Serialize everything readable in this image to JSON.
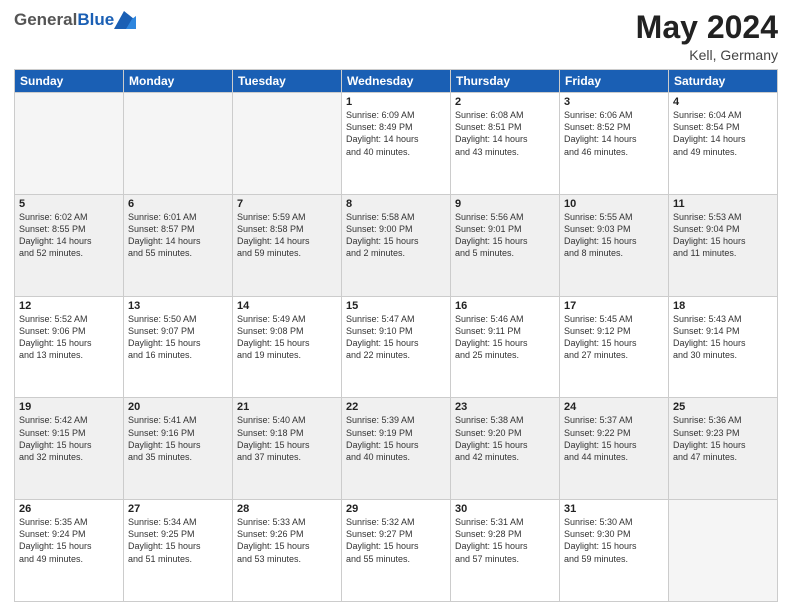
{
  "header": {
    "logo_general": "General",
    "logo_blue": "Blue",
    "month_year": "May 2024",
    "location": "Kell, Germany"
  },
  "days_header": [
    "Sunday",
    "Monday",
    "Tuesday",
    "Wednesday",
    "Thursday",
    "Friday",
    "Saturday"
  ],
  "weeks": [
    {
      "shaded": false,
      "days": [
        {
          "num": "",
          "info": ""
        },
        {
          "num": "",
          "info": ""
        },
        {
          "num": "",
          "info": ""
        },
        {
          "num": "1",
          "info": "Sunrise: 6:09 AM\nSunset: 8:49 PM\nDaylight: 14 hours\nand 40 minutes."
        },
        {
          "num": "2",
          "info": "Sunrise: 6:08 AM\nSunset: 8:51 PM\nDaylight: 14 hours\nand 43 minutes."
        },
        {
          "num": "3",
          "info": "Sunrise: 6:06 AM\nSunset: 8:52 PM\nDaylight: 14 hours\nand 46 minutes."
        },
        {
          "num": "4",
          "info": "Sunrise: 6:04 AM\nSunset: 8:54 PM\nDaylight: 14 hours\nand 49 minutes."
        }
      ]
    },
    {
      "shaded": true,
      "days": [
        {
          "num": "5",
          "info": "Sunrise: 6:02 AM\nSunset: 8:55 PM\nDaylight: 14 hours\nand 52 minutes."
        },
        {
          "num": "6",
          "info": "Sunrise: 6:01 AM\nSunset: 8:57 PM\nDaylight: 14 hours\nand 55 minutes."
        },
        {
          "num": "7",
          "info": "Sunrise: 5:59 AM\nSunset: 8:58 PM\nDaylight: 14 hours\nand 59 minutes."
        },
        {
          "num": "8",
          "info": "Sunrise: 5:58 AM\nSunset: 9:00 PM\nDaylight: 15 hours\nand 2 minutes."
        },
        {
          "num": "9",
          "info": "Sunrise: 5:56 AM\nSunset: 9:01 PM\nDaylight: 15 hours\nand 5 minutes."
        },
        {
          "num": "10",
          "info": "Sunrise: 5:55 AM\nSunset: 9:03 PM\nDaylight: 15 hours\nand 8 minutes."
        },
        {
          "num": "11",
          "info": "Sunrise: 5:53 AM\nSunset: 9:04 PM\nDaylight: 15 hours\nand 11 minutes."
        }
      ]
    },
    {
      "shaded": false,
      "days": [
        {
          "num": "12",
          "info": "Sunrise: 5:52 AM\nSunset: 9:06 PM\nDaylight: 15 hours\nand 13 minutes."
        },
        {
          "num": "13",
          "info": "Sunrise: 5:50 AM\nSunset: 9:07 PM\nDaylight: 15 hours\nand 16 minutes."
        },
        {
          "num": "14",
          "info": "Sunrise: 5:49 AM\nSunset: 9:08 PM\nDaylight: 15 hours\nand 19 minutes."
        },
        {
          "num": "15",
          "info": "Sunrise: 5:47 AM\nSunset: 9:10 PM\nDaylight: 15 hours\nand 22 minutes."
        },
        {
          "num": "16",
          "info": "Sunrise: 5:46 AM\nSunset: 9:11 PM\nDaylight: 15 hours\nand 25 minutes."
        },
        {
          "num": "17",
          "info": "Sunrise: 5:45 AM\nSunset: 9:12 PM\nDaylight: 15 hours\nand 27 minutes."
        },
        {
          "num": "18",
          "info": "Sunrise: 5:43 AM\nSunset: 9:14 PM\nDaylight: 15 hours\nand 30 minutes."
        }
      ]
    },
    {
      "shaded": true,
      "days": [
        {
          "num": "19",
          "info": "Sunrise: 5:42 AM\nSunset: 9:15 PM\nDaylight: 15 hours\nand 32 minutes."
        },
        {
          "num": "20",
          "info": "Sunrise: 5:41 AM\nSunset: 9:16 PM\nDaylight: 15 hours\nand 35 minutes."
        },
        {
          "num": "21",
          "info": "Sunrise: 5:40 AM\nSunset: 9:18 PM\nDaylight: 15 hours\nand 37 minutes."
        },
        {
          "num": "22",
          "info": "Sunrise: 5:39 AM\nSunset: 9:19 PM\nDaylight: 15 hours\nand 40 minutes."
        },
        {
          "num": "23",
          "info": "Sunrise: 5:38 AM\nSunset: 9:20 PM\nDaylight: 15 hours\nand 42 minutes."
        },
        {
          "num": "24",
          "info": "Sunrise: 5:37 AM\nSunset: 9:22 PM\nDaylight: 15 hours\nand 44 minutes."
        },
        {
          "num": "25",
          "info": "Sunrise: 5:36 AM\nSunset: 9:23 PM\nDaylight: 15 hours\nand 47 minutes."
        }
      ]
    },
    {
      "shaded": false,
      "days": [
        {
          "num": "26",
          "info": "Sunrise: 5:35 AM\nSunset: 9:24 PM\nDaylight: 15 hours\nand 49 minutes."
        },
        {
          "num": "27",
          "info": "Sunrise: 5:34 AM\nSunset: 9:25 PM\nDaylight: 15 hours\nand 51 minutes."
        },
        {
          "num": "28",
          "info": "Sunrise: 5:33 AM\nSunset: 9:26 PM\nDaylight: 15 hours\nand 53 minutes."
        },
        {
          "num": "29",
          "info": "Sunrise: 5:32 AM\nSunset: 9:27 PM\nDaylight: 15 hours\nand 55 minutes."
        },
        {
          "num": "30",
          "info": "Sunrise: 5:31 AM\nSunset: 9:28 PM\nDaylight: 15 hours\nand 57 minutes."
        },
        {
          "num": "31",
          "info": "Sunrise: 5:30 AM\nSunset: 9:30 PM\nDaylight: 15 hours\nand 59 minutes."
        },
        {
          "num": "",
          "info": ""
        }
      ]
    }
  ]
}
